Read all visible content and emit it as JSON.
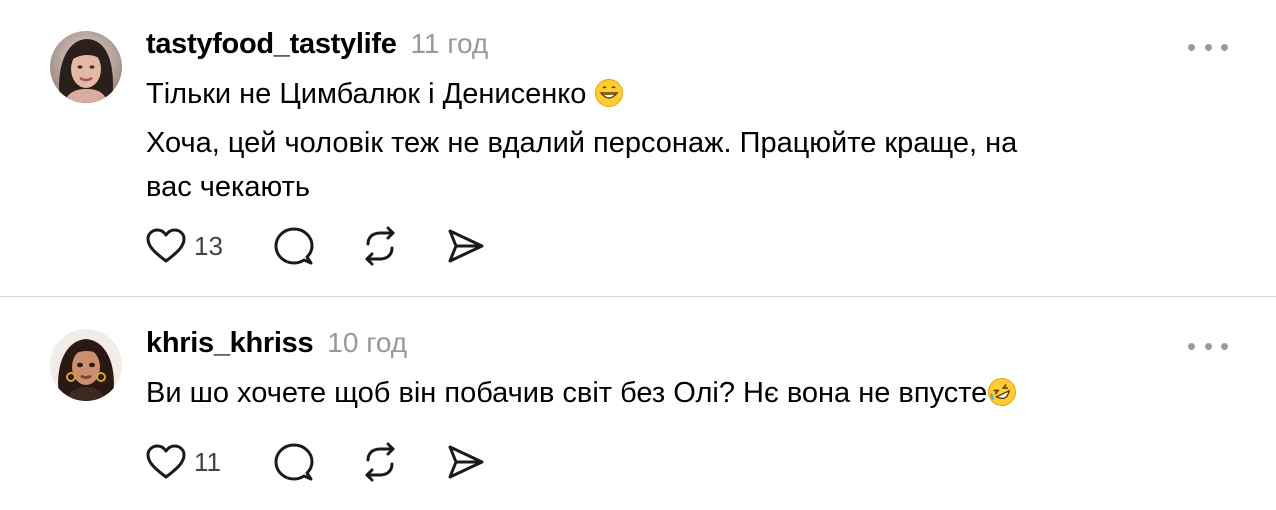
{
  "posts": [
    {
      "username": "tastyfood_tastylife",
      "time": "11 год",
      "lines": [
        "Тільки не Цимбалюк і Денисенко",
        "Хоча, цей чоловік теж не вдалий персонаж. Працюйте краще, на",
        "вас чекають"
      ],
      "emoji_line1": "grinning-face-emoji",
      "likes": "13"
    },
    {
      "username": "khris_khriss",
      "time": "10 год",
      "lines": [
        "Ви шо хочете щоб він побачив світ без Олі? Нє вона не впусте"
      ],
      "emoji_line1": "rolling-on-floor-laughing-emoji",
      "likes": "11"
    }
  ],
  "icons": {
    "like": "heart-icon",
    "reply": "speech-bubble-icon",
    "repost": "repost-icon",
    "share": "send-icon",
    "more": "more-options-icon"
  },
  "colors": {
    "text": "#000000",
    "muted": "#999999",
    "icon": "#1a1a1a",
    "divider": "#d9d9d9"
  }
}
